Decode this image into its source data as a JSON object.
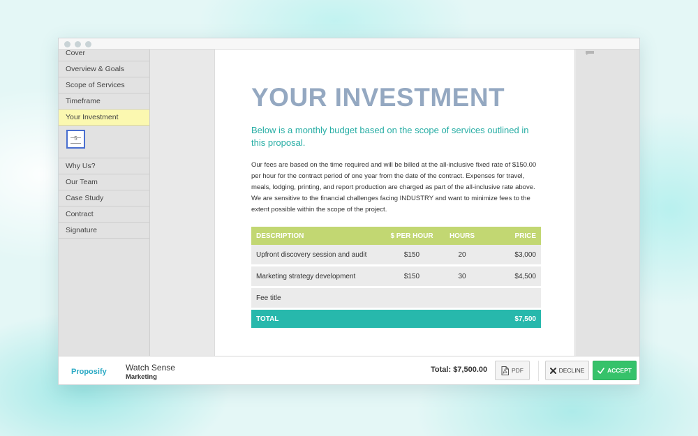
{
  "sidebar": {
    "items": [
      {
        "label": "Cover"
      },
      {
        "label": "Overview & Goals"
      },
      {
        "label": "Scope of Services"
      },
      {
        "label": "Timeframe"
      },
      {
        "label": "Your Investment",
        "active": true
      },
      {
        "label": "Why Us?"
      },
      {
        "label": "Our Team"
      },
      {
        "label": "Case Study"
      },
      {
        "label": "Contract"
      },
      {
        "label": "Signature"
      }
    ],
    "thumbnail_label": "5"
  },
  "page": {
    "title": "YOUR INVESTMENT",
    "subtitle": "Below is a monthly budget based on the scope of services outlined in this proposal.",
    "body": "Our fees are based on the time required and will be billed at the all-inclusive fixed rate of $150.00 per hour for the contract period of one year from the date of the contract. Expenses for travel, meals, lodging, printing, and report production are charged as part of the all-inclusive rate above. We are sensitive to the financial challenges facing INDUSTRY and want to minimize fees to the extent possible within the scope of the project."
  },
  "fee_table": {
    "headers": {
      "description": "DESCRIPTION",
      "rate": "$ PER HOUR",
      "hours": "HOURS",
      "price": "PRICE"
    },
    "rows": [
      {
        "description": "Upfront discovery session and audit",
        "rate": "$150",
        "hours": "20",
        "price": "$3,000"
      },
      {
        "description": "Marketing strategy development",
        "rate": "$150",
        "hours": "30",
        "price": "$4,500"
      },
      {
        "description": "Fee title",
        "rate": "",
        "hours": "",
        "price": ""
      }
    ],
    "total": {
      "label": "TOTAL",
      "price": "$7,500"
    }
  },
  "footer": {
    "brand": "Proposify",
    "client_name": "Watch Sense",
    "client_type": "Marketing",
    "total_label": "Total:",
    "total_value": "$7,500.00",
    "pdf_label": "PDF",
    "decline_label": "DECLINE",
    "accept_label": "ACCEPT"
  },
  "colors": {
    "title": "#94a8c1",
    "subtitle": "#26ada4",
    "table_header": "#c2d772",
    "table_total": "#27b8ac",
    "accept": "#36c26a",
    "active_nav": "#fbf8b0"
  },
  "icons": {
    "pdf": "pdf-file-icon",
    "decline": "x-icon",
    "accept": "checkmark-icon",
    "comment": "comment-icon"
  }
}
